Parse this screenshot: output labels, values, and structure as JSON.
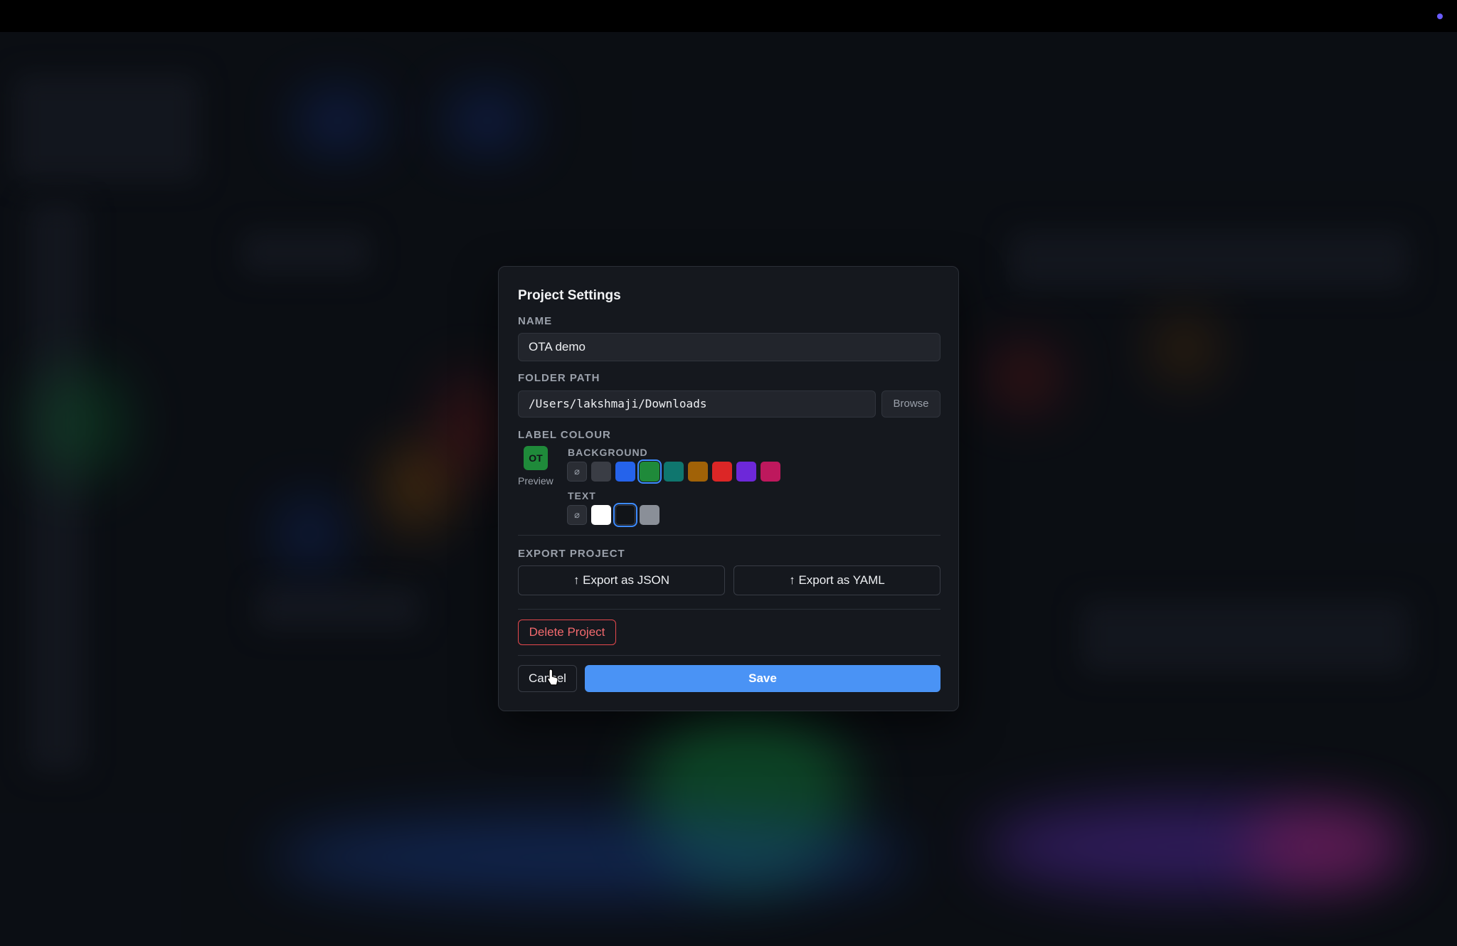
{
  "modal": {
    "title": "Project Settings",
    "name_label": "NAME",
    "name_value": "OTA demo",
    "folder_label": "FOLDER PATH",
    "folder_value": "/Users/lakshmaji/Downloads",
    "browse_label": "Browse",
    "label_colour_label": "LABEL COLOUR",
    "preview_text": "OT",
    "preview_label": "Preview",
    "background_label": "BACKGROUND",
    "text_label": "TEXT",
    "none_symbol": "⌀",
    "background_swatches": [
      "none",
      "#3a3d45",
      "#2563eb",
      "#1f8a3a",
      "#0f766e",
      "#a16207",
      "#dc2626",
      "#6d28d9",
      "#be185d"
    ],
    "background_selected": "#1f8a3a",
    "text_swatches": [
      "none",
      "#ffffff",
      "#111418",
      "#8a8f98"
    ],
    "text_selected": "#111418",
    "export_label": "EXPORT PROJECT",
    "export_json": "↑ Export as JSON",
    "export_yaml": "↑ Export as YAML",
    "delete_label": "Delete Project",
    "cancel_label": "Cancel",
    "save_label": "Save"
  },
  "colors": {
    "accent": "#4a93f5",
    "danger": "#e5484d",
    "modal_bg": "#15181e"
  }
}
